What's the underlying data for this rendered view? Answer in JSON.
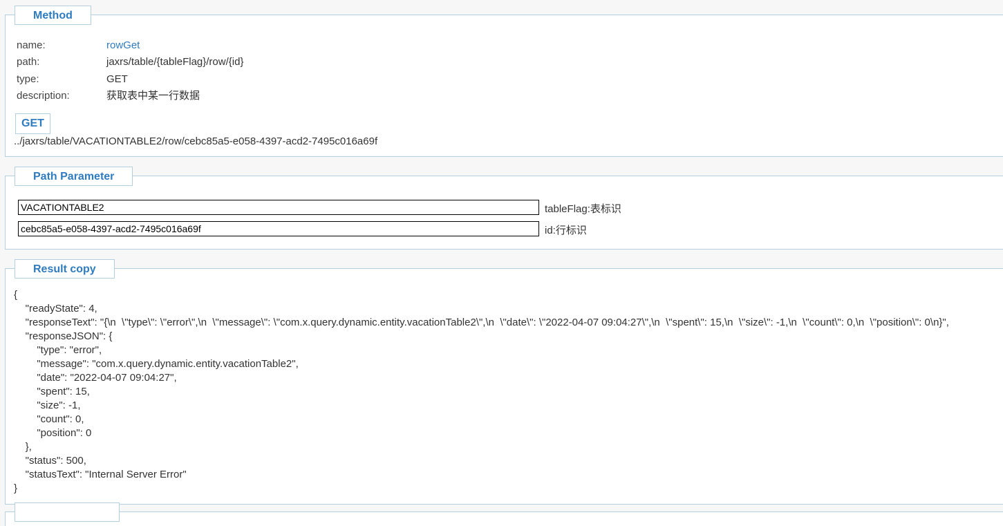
{
  "method_section": {
    "legend": "Method",
    "fields": [
      {
        "key": "name:",
        "value": "rowGet"
      },
      {
        "key": "path:",
        "value": "jaxrs/table/{tableFlag}/row/{id}"
      },
      {
        "key": "type:",
        "value": "GET"
      },
      {
        "key": "description:",
        "value": "获取表中某一行数据"
      }
    ],
    "get_button": "GET",
    "url": "../jaxrs/table/VACATIONTABLE2/row/cebc85a5-e058-4397-acd2-7495c016a69f"
  },
  "path_section": {
    "legend": "Path Parameter",
    "params": [
      {
        "value": "VACATIONTABLE2",
        "label": "tableFlag:表标识"
      },
      {
        "value": "cebc85a5-e058-4397-acd2-7495c016a69f",
        "label": "id:行标识"
      }
    ]
  },
  "result_section": {
    "legend": "Result copy",
    "text": "{\n    \"readyState\": 4,\n    \"responseText\": \"{\\n  \\\"type\\\": \\\"error\\\",\\n  \\\"message\\\": \\\"com.x.query.dynamic.entity.vacationTable2\\\",\\n  \\\"date\\\": \\\"2022-04-07 09:04:27\\\",\\n  \\\"spent\\\": 15,\\n  \\\"size\\\": -1,\\n  \\\"count\\\": 0,\\n  \\\"position\\\": 0\\n}\",\n    \"responseJSON\": {\n        \"type\": \"error\",\n        \"message\": \"com.x.query.dynamic.entity.vacationTable2\",\n        \"date\": \"2022-04-07 09:04:27\",\n        \"spent\": 15,\n        \"size\": -1,\n        \"count\": 0,\n        \"position\": 0\n    },\n    \"status\": 500,\n    \"statusText\": \"Internal Server Error\"\n}"
  },
  "colors": {
    "accent": "#2e7bc0",
    "border": "#b3cfe0",
    "background": "#f7f7f7"
  }
}
